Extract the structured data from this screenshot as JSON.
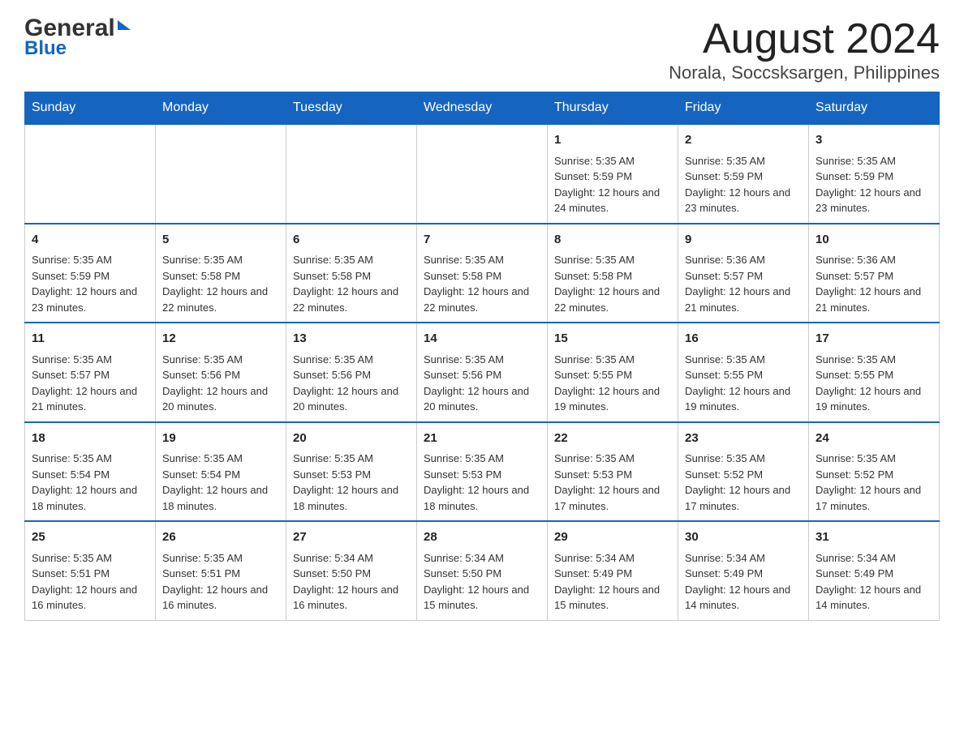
{
  "header": {
    "month_title": "August 2024",
    "location": "Norala, Soccsksargen, Philippines"
  },
  "logo": {
    "line1": "General",
    "line2": "Blue"
  },
  "days_of_week": [
    "Sunday",
    "Monday",
    "Tuesday",
    "Wednesday",
    "Thursday",
    "Friday",
    "Saturday"
  ],
  "weeks": [
    {
      "days": [
        {
          "number": "",
          "info": ""
        },
        {
          "number": "",
          "info": ""
        },
        {
          "number": "",
          "info": ""
        },
        {
          "number": "",
          "info": ""
        },
        {
          "number": "1",
          "info": "Sunrise: 5:35 AM\nSunset: 5:59 PM\nDaylight: 12 hours and 24 minutes."
        },
        {
          "number": "2",
          "info": "Sunrise: 5:35 AM\nSunset: 5:59 PM\nDaylight: 12 hours and 23 minutes."
        },
        {
          "number": "3",
          "info": "Sunrise: 5:35 AM\nSunset: 5:59 PM\nDaylight: 12 hours and 23 minutes."
        }
      ]
    },
    {
      "days": [
        {
          "number": "4",
          "info": "Sunrise: 5:35 AM\nSunset: 5:59 PM\nDaylight: 12 hours and 23 minutes."
        },
        {
          "number": "5",
          "info": "Sunrise: 5:35 AM\nSunset: 5:58 PM\nDaylight: 12 hours and 22 minutes."
        },
        {
          "number": "6",
          "info": "Sunrise: 5:35 AM\nSunset: 5:58 PM\nDaylight: 12 hours and 22 minutes."
        },
        {
          "number": "7",
          "info": "Sunrise: 5:35 AM\nSunset: 5:58 PM\nDaylight: 12 hours and 22 minutes."
        },
        {
          "number": "8",
          "info": "Sunrise: 5:35 AM\nSunset: 5:58 PM\nDaylight: 12 hours and 22 minutes."
        },
        {
          "number": "9",
          "info": "Sunrise: 5:36 AM\nSunset: 5:57 PM\nDaylight: 12 hours and 21 minutes."
        },
        {
          "number": "10",
          "info": "Sunrise: 5:36 AM\nSunset: 5:57 PM\nDaylight: 12 hours and 21 minutes."
        }
      ]
    },
    {
      "days": [
        {
          "number": "11",
          "info": "Sunrise: 5:35 AM\nSunset: 5:57 PM\nDaylight: 12 hours and 21 minutes."
        },
        {
          "number": "12",
          "info": "Sunrise: 5:35 AM\nSunset: 5:56 PM\nDaylight: 12 hours and 20 minutes."
        },
        {
          "number": "13",
          "info": "Sunrise: 5:35 AM\nSunset: 5:56 PM\nDaylight: 12 hours and 20 minutes."
        },
        {
          "number": "14",
          "info": "Sunrise: 5:35 AM\nSunset: 5:56 PM\nDaylight: 12 hours and 20 minutes."
        },
        {
          "number": "15",
          "info": "Sunrise: 5:35 AM\nSunset: 5:55 PM\nDaylight: 12 hours and 19 minutes."
        },
        {
          "number": "16",
          "info": "Sunrise: 5:35 AM\nSunset: 5:55 PM\nDaylight: 12 hours and 19 minutes."
        },
        {
          "number": "17",
          "info": "Sunrise: 5:35 AM\nSunset: 5:55 PM\nDaylight: 12 hours and 19 minutes."
        }
      ]
    },
    {
      "days": [
        {
          "number": "18",
          "info": "Sunrise: 5:35 AM\nSunset: 5:54 PM\nDaylight: 12 hours and 18 minutes."
        },
        {
          "number": "19",
          "info": "Sunrise: 5:35 AM\nSunset: 5:54 PM\nDaylight: 12 hours and 18 minutes."
        },
        {
          "number": "20",
          "info": "Sunrise: 5:35 AM\nSunset: 5:53 PM\nDaylight: 12 hours and 18 minutes."
        },
        {
          "number": "21",
          "info": "Sunrise: 5:35 AM\nSunset: 5:53 PM\nDaylight: 12 hours and 18 minutes."
        },
        {
          "number": "22",
          "info": "Sunrise: 5:35 AM\nSunset: 5:53 PM\nDaylight: 12 hours and 17 minutes."
        },
        {
          "number": "23",
          "info": "Sunrise: 5:35 AM\nSunset: 5:52 PM\nDaylight: 12 hours and 17 minutes."
        },
        {
          "number": "24",
          "info": "Sunrise: 5:35 AM\nSunset: 5:52 PM\nDaylight: 12 hours and 17 minutes."
        }
      ]
    },
    {
      "days": [
        {
          "number": "25",
          "info": "Sunrise: 5:35 AM\nSunset: 5:51 PM\nDaylight: 12 hours and 16 minutes."
        },
        {
          "number": "26",
          "info": "Sunrise: 5:35 AM\nSunset: 5:51 PM\nDaylight: 12 hours and 16 minutes."
        },
        {
          "number": "27",
          "info": "Sunrise: 5:34 AM\nSunset: 5:50 PM\nDaylight: 12 hours and 16 minutes."
        },
        {
          "number": "28",
          "info": "Sunrise: 5:34 AM\nSunset: 5:50 PM\nDaylight: 12 hours and 15 minutes."
        },
        {
          "number": "29",
          "info": "Sunrise: 5:34 AM\nSunset: 5:49 PM\nDaylight: 12 hours and 15 minutes."
        },
        {
          "number": "30",
          "info": "Sunrise: 5:34 AM\nSunset: 5:49 PM\nDaylight: 12 hours and 14 minutes."
        },
        {
          "number": "31",
          "info": "Sunrise: 5:34 AM\nSunset: 5:49 PM\nDaylight: 12 hours and 14 minutes."
        }
      ]
    }
  ]
}
